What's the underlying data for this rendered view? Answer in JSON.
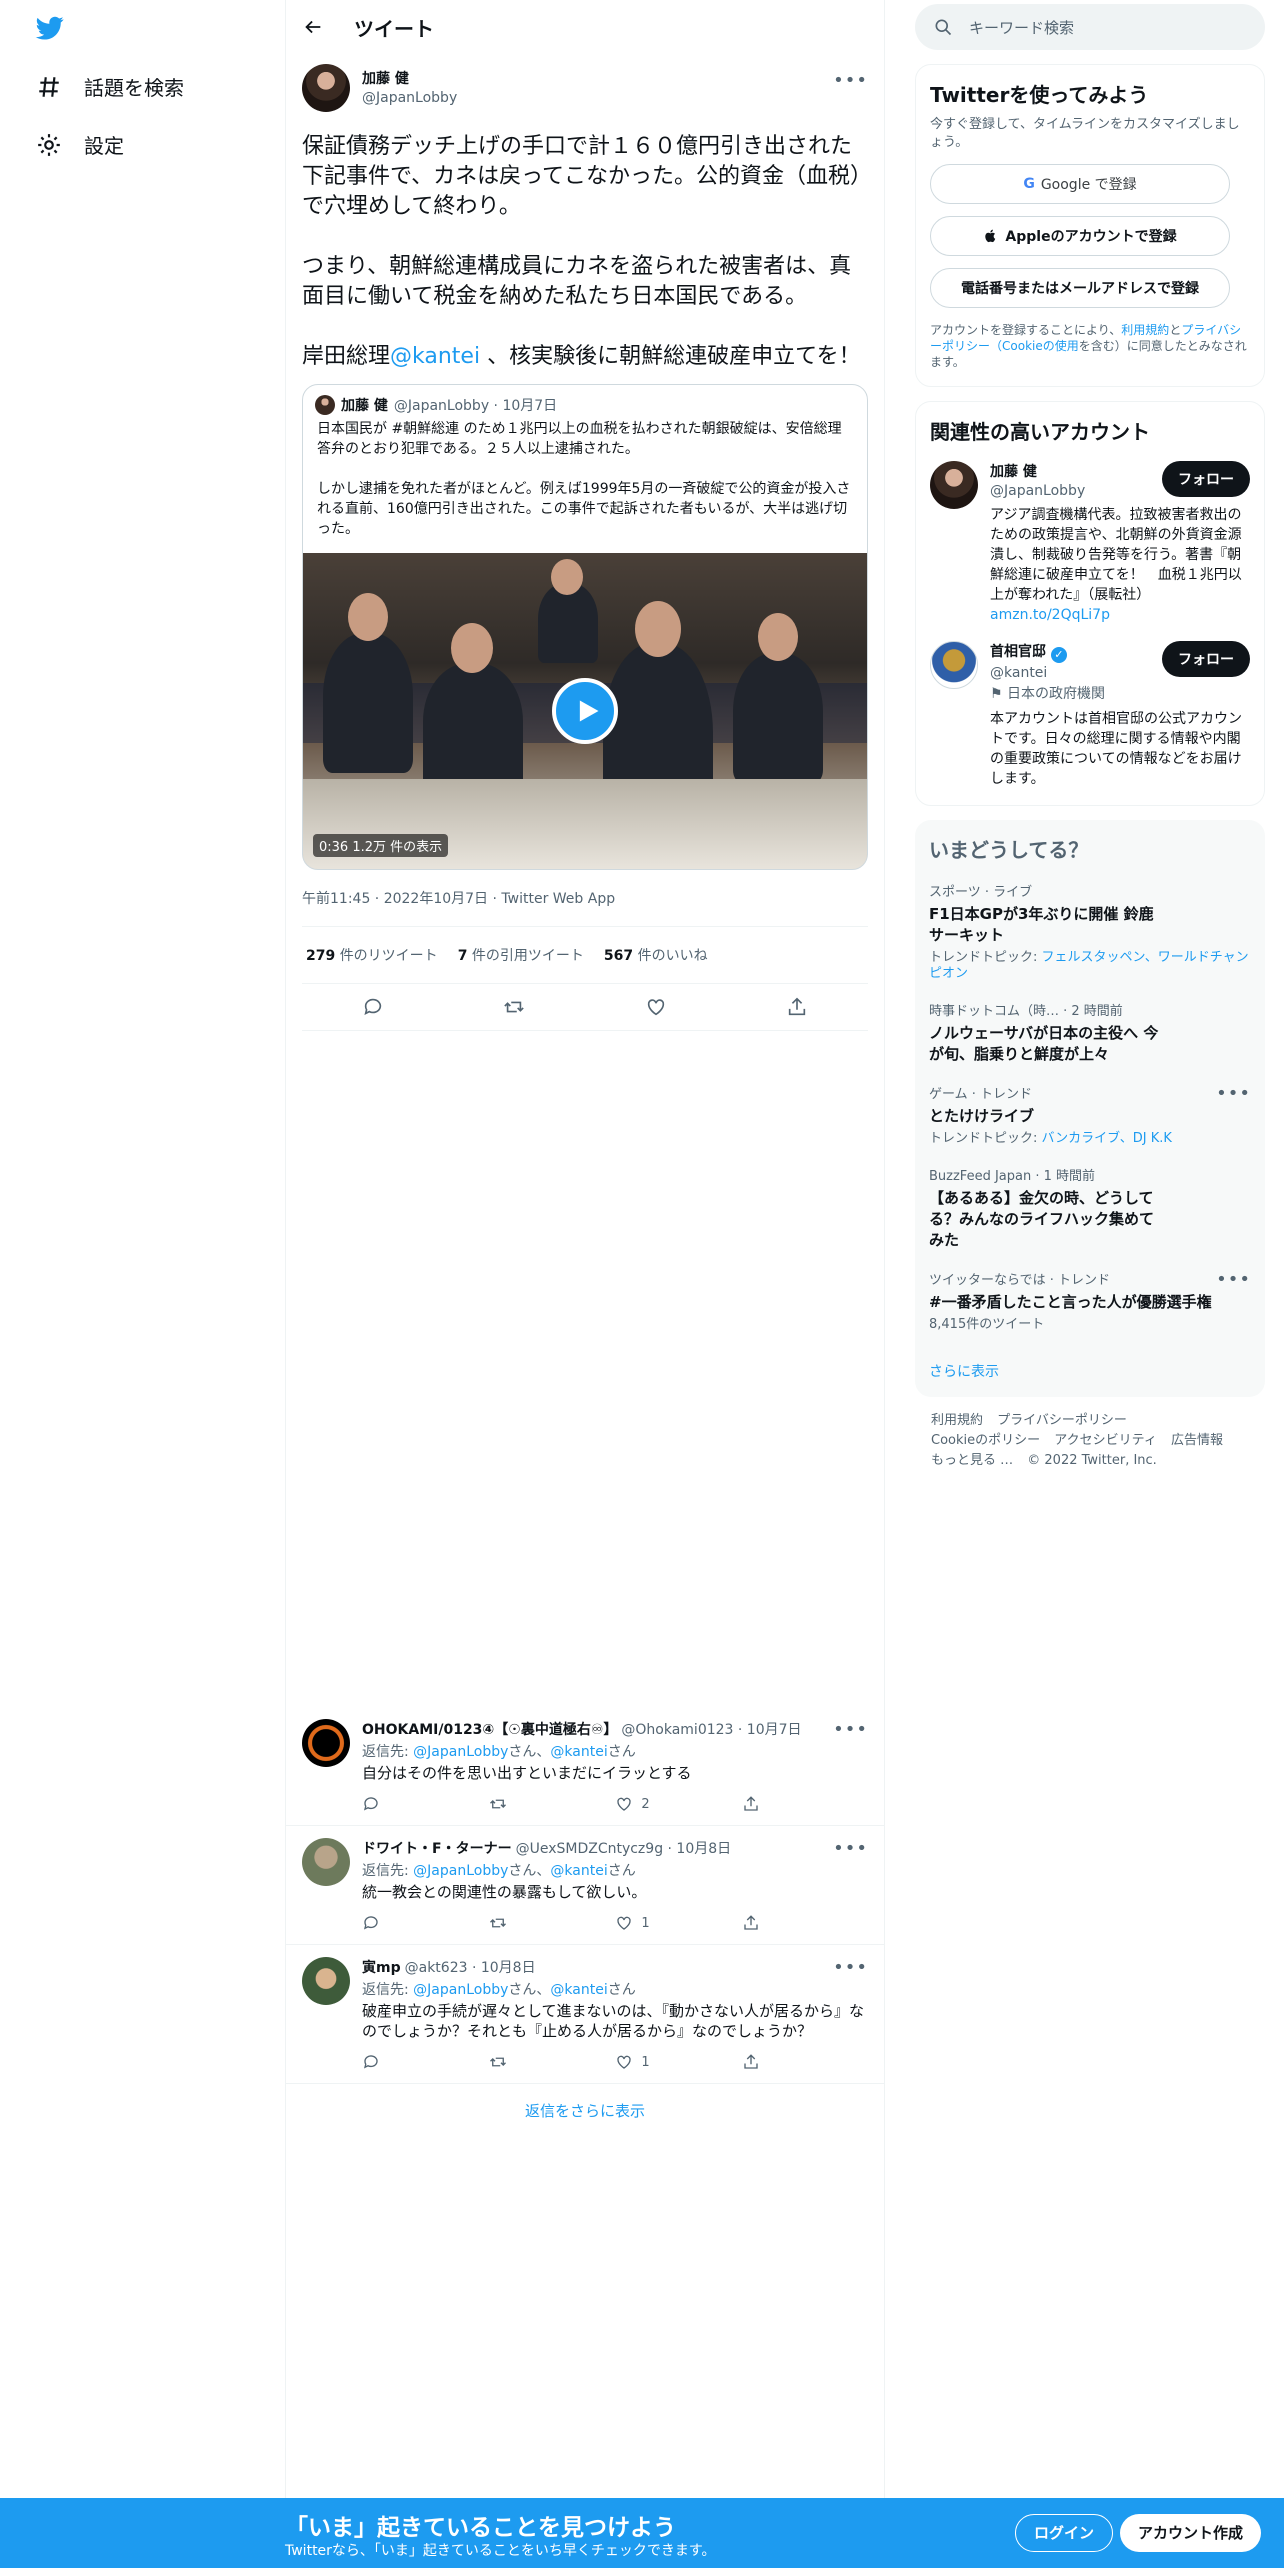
{
  "nav": {
    "items": [
      {
        "label": "話題を検索",
        "icon": "hashtag-icon"
      },
      {
        "label": "設定",
        "icon": "gear-icon"
      }
    ]
  },
  "header": {
    "title": "ツイート"
  },
  "tweet": {
    "display_name": "加藤 健",
    "handle": "@JapanLobby",
    "text_p1": "保証債務デッチ上げの手口で計１６０億円引き出された下記事件で、カネは戻ってこなかった。公的資金（血税）で穴埋めして終わり。",
    "text_p2": "つまり、朝鮮総連構成員にカネを盗られた被害者は、真面目に働いて税金を納めた私たち日本国民である。",
    "text_p3_pre": "岸田総理",
    "text_p3_mention": "@kantei",
    "text_p3_post": " 、核実験後に朝鮮総連破産申立てを！",
    "quote": {
      "display_name": "加藤 健",
      "handle_date": "@JapanLobby · 10月7日",
      "text": "日本国民が #朝鮮総連 のため１兆円以上の血税を払わされた朝銀破綻は、安倍総理答弁のとおり犯罪である。２５人以上逮捕された。\n\nしかし逮捕を免れた者がほとんど。例えば1999年5月の一斉破綻で公的資金が投入される直前、160億円引き出された。この事件で起訴された者もいるが、大半は逃げ切った。",
      "video_info": "0:36  1.2万 件の表示"
    },
    "meta": "午前11:45 · 2022年10月7日 · Twitter Web App",
    "stats": {
      "retweets_n": "279",
      "retweets_l": "件のリツイート",
      "quotes_n": "7",
      "quotes_l": "件の引用ツイート",
      "likes_n": "567",
      "likes_l": "件のいいね"
    }
  },
  "replies": [
    {
      "name": "OHOKAMI/0123④【☉裏中道極右♾】",
      "handle": "@Ohokami0123 · 10月7日",
      "reply_to_label": "返信先:",
      "reply_to_1": "@JapanLobby",
      "san_1": "さん、",
      "reply_to_2": "@kantei",
      "san_2": "さん",
      "text": "自分はその件を思い出すといまだにイラッとする",
      "likes": "2"
    },
    {
      "name": "ドワイト・F・ターナー",
      "handle": "@UexSMDZCntycz9g · 10月8日",
      "reply_to_label": "返信先:",
      "reply_to_1": "@JapanLobby",
      "san_1": "さん、",
      "reply_to_2": "@kantei",
      "san_2": "さん",
      "text": "統一教会との関連性の暴露もして欲しい。",
      "likes": "1"
    },
    {
      "name": "寅mp",
      "handle": "@akt623 · 10月8日",
      "reply_to_label": "返信先:",
      "reply_to_1": "@JapanLobby",
      "san_1": "さん、",
      "reply_to_2": "@kantei",
      "san_2": "さん",
      "text": "破産申立の手続が遅々として進まないのは、『動かさない人が居るから』なのでしょうか？それとも『止める人が居るから』なのでしょうか？",
      "likes": "1"
    }
  ],
  "show_more_replies": "返信をさらに表示",
  "search": {
    "placeholder": "キーワード検索"
  },
  "signup_card": {
    "title": "Twitterを使ってみよう",
    "subtitle": "今すぐ登録して、タイムラインをカスタマイズしましょう。",
    "google": "Google で登録",
    "apple": "Appleのアカウントで登録",
    "phone": "電話番号またはメールアドレスで登録",
    "terms_pre": "アカウントを登録することにより、",
    "terms_link1": "利用規約",
    "terms_mid": "と",
    "terms_link2": "プライバシーポリシー（Cookieの使用",
    "terms_post": "を含む）に同意したとみなされます。"
  },
  "related": {
    "title": "関連性の高いアカウント",
    "accounts": [
      {
        "name": "加藤 健",
        "handle": "@JapanLobby",
        "follow": "フォロー",
        "bio": "アジア調査機構代表。拉致被害者救出のための政策提言や、北朝鮮の外貨資金源潰し、制裁破り告発等を行う。著書『朝鮮総連に破産申立てを！　血税１兆円以上が奪われた』（展転社）",
        "link": "amzn.to/2QqLi7p"
      },
      {
        "name": "首相官邸",
        "handle": "@kantei",
        "follow": "フォロー",
        "label": "⚑ 日本の政府機関",
        "bio": "本アカウントは首相官邸の公式アカウントです。日々の総理に関する情報や内閣の重要政策についての情報などをお届けします。"
      }
    ]
  },
  "trends": {
    "title": "いまどうしてる？",
    "items": [
      {
        "context": "スポーツ · ライブ",
        "title": "F1日本GPが3年ぶりに開催 鈴鹿サーキット",
        "topics_label": "トレンドトピック: ",
        "topics": "フェルスタッペン、ワールドチャンピオン"
      },
      {
        "context": "時事ドットコム（時… · 2 時間前",
        "title": "ノルウェーサバが日本の主役へ 今が旬、脂乗りと鮮度が上々"
      },
      {
        "context": "ゲーム · トレンド",
        "title": "とたけけライブ",
        "topics_label": "トレンドトピック: ",
        "topics": "バンカライブ、DJ K.K"
      },
      {
        "context": "BuzzFeed Japan · 1 時間前",
        "title": "【あるある】金欠の時、どうしてる？みんなのライフハック集めてみた"
      },
      {
        "context": "ツイッターならでは · トレンド",
        "title": "#一番矛盾したこと言った人が優勝選手権",
        "count": "8,415件のツイート"
      }
    ],
    "show_more": "さらに表示"
  },
  "footer": {
    "links": [
      "利用規約",
      "プライバシーポリシー",
      "Cookieのポリシー",
      "アクセシビリティ",
      "広告情報",
      "もっと見る …",
      "© 2022 Twitter, Inc."
    ]
  },
  "bottom_bar": {
    "title": "「いま」起きていることを見つけよう",
    "subtitle": "Twitterなら、「いま」起きていることをいち早くチェックできます。",
    "login": "ログイン",
    "signup": "アカウント作成"
  },
  "colors": {
    "accent": "#1d9bf0",
    "text": "#0f1419",
    "muted": "#536471"
  }
}
